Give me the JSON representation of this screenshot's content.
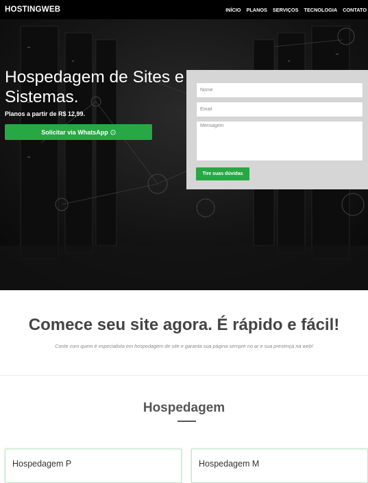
{
  "nav": {
    "brand": "HOSTINGWEB",
    "items": [
      {
        "label": "INÍCIO"
      },
      {
        "label": "PLANOS"
      },
      {
        "label": "SERVIÇOS"
      },
      {
        "label": "TECNOLOGIA"
      },
      {
        "label": "CONTATO"
      }
    ]
  },
  "hero": {
    "title": "Hospedagem de Sites e Sistemas.",
    "subtitle": "Planos a partir de R$ 12,99.",
    "whatsapp_button": "Solicitar via WhatsApp",
    "whatsapp_icon": "whatsapp-icon",
    "form": {
      "name_placeholder": "Nome",
      "email_placeholder": "Email",
      "message_placeholder": "Mensagem",
      "submit_label": "Tire suas dúvidas"
    }
  },
  "intro": {
    "title": "Comece seu site agora. É rápido e fácil!",
    "subtitle": "Conte com quem é especialista em hospedagem de site e garanta sua página sempre no ar e sua presença na web!"
  },
  "plans_section": {
    "title": "Hospedagem",
    "plans": [
      {
        "name": "Hospedagem P"
      },
      {
        "name": "Hospedagem M"
      }
    ]
  },
  "colors": {
    "accent": "#28a745",
    "nav_bg": "#000000",
    "hero_bg": "#161616",
    "form_bg": "#d6d6d6"
  }
}
